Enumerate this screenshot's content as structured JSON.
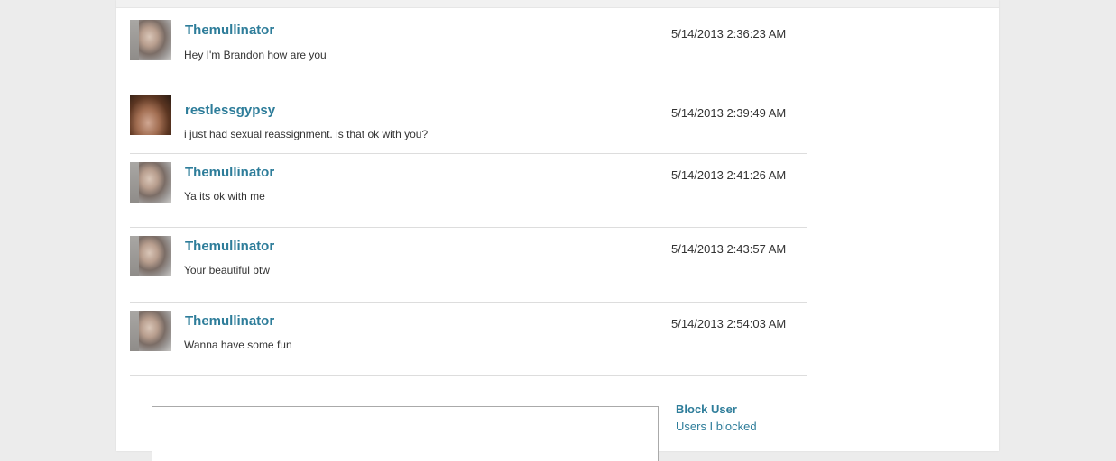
{
  "messages": [
    {
      "username": "Themullinator",
      "timestamp": "5/14/2013 2:36:23 AM",
      "text": "Hey I'm Brandon how are you",
      "avatar": "profile-photo"
    },
    {
      "username": "restlessgypsy",
      "timestamp": "5/14/2013 2:39:49 AM",
      "text": "i just had sexual reassignment. is that ok with you?",
      "avatar": "profile-photo"
    },
    {
      "username": "Themullinator",
      "timestamp": "5/14/2013 2:41:26 AM",
      "text": "Ya its ok with me",
      "avatar": "profile-photo"
    },
    {
      "username": "Themullinator",
      "timestamp": "5/14/2013 2:43:57 AM",
      "text": "Your beautiful btw",
      "avatar": "profile-photo"
    },
    {
      "username": "Themullinator",
      "timestamp": "5/14/2013 2:54:03 AM",
      "text": "Wanna have some fun",
      "avatar": "profile-photo"
    }
  ],
  "sidebar": {
    "block_user": "Block User",
    "users_blocked": "Users I blocked"
  },
  "colors": {
    "link": "#2e7d9a",
    "text": "#333333",
    "background": "#ececec"
  }
}
